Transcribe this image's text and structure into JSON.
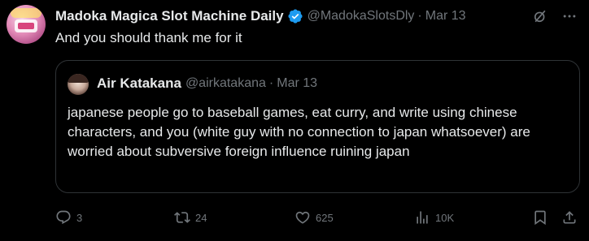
{
  "post": {
    "display_name": "Madoka Magica Slot Machine Daily",
    "handle": "@MadokaSlotsDly",
    "separator": "·",
    "date": "Mar 13",
    "text": "And you should thank me for it"
  },
  "quoted": {
    "display_name": "Air Katakana",
    "handle": "@airkatakana",
    "separator": "·",
    "date": "Mar 13",
    "text": "japanese people go to baseball games, eat curry, and write using chinese characters, and you (white guy with no connection to japan whatsoever) are worried about subversive foreign influence ruining japan"
  },
  "actions": {
    "replies": "3",
    "reposts": "24",
    "likes": "625",
    "views": "10K"
  },
  "icons": {
    "verified": "verified-badge-icon",
    "grok": "grok-icon",
    "reply": "reply-icon",
    "repost": "repost-icon",
    "like": "heart-icon",
    "views": "views-bar-icon",
    "bookmark": "bookmark-icon",
    "share": "share-icon"
  },
  "colors": {
    "background": "#000000",
    "text": "#e7e9ea",
    "muted": "#71767b",
    "verified": "#1d9bf0",
    "border": "#2f3336"
  }
}
